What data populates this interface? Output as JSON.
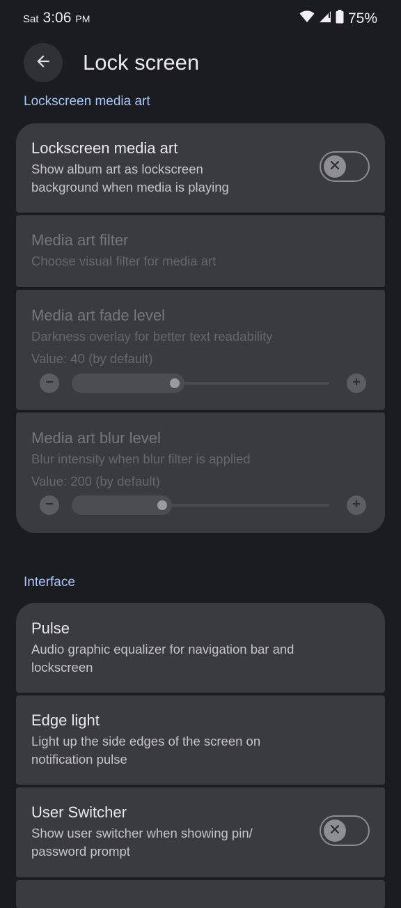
{
  "status": {
    "day": "Sat",
    "time": "3:06",
    "ampm": "PM",
    "battery": "75%"
  },
  "appbar": {
    "title": "Lock screen"
  },
  "sections": {
    "media": {
      "header": "Lockscreen media art",
      "media_art": {
        "title": "Lockscreen media art",
        "subtitle": "Show album art as lockscreen background when media is playing",
        "toggle_on": false
      },
      "filter": {
        "title": "Media art filter",
        "subtitle": "Choose visual filter for media art"
      },
      "fade": {
        "title": "Media art fade level",
        "subtitle": "Darkness overlay for better text readability",
        "value_text": "Value: 40 (by default)",
        "value_fraction": 0.4
      },
      "blur": {
        "title": "Media art blur level",
        "subtitle": "Blur intensity when blur filter is applied",
        "value_text": "Value: 200 (by default)",
        "value_fraction": 0.35
      }
    },
    "interface": {
      "header": "Interface",
      "pulse": {
        "title": "Pulse",
        "subtitle": "Audio graphic equalizer for navigation bar and lockscreen"
      },
      "edge_light": {
        "title": "Edge light",
        "subtitle": "Light up the side edges of the screen on notification pulse"
      },
      "user_switcher": {
        "title": "User Switcher",
        "subtitle": "Show user switcher when showing pin/ password prompt",
        "toggle_on": false
      }
    }
  },
  "colors": {
    "background": "#1b1c20",
    "card": "#3a3b40",
    "accent": "#a8c7fa"
  }
}
